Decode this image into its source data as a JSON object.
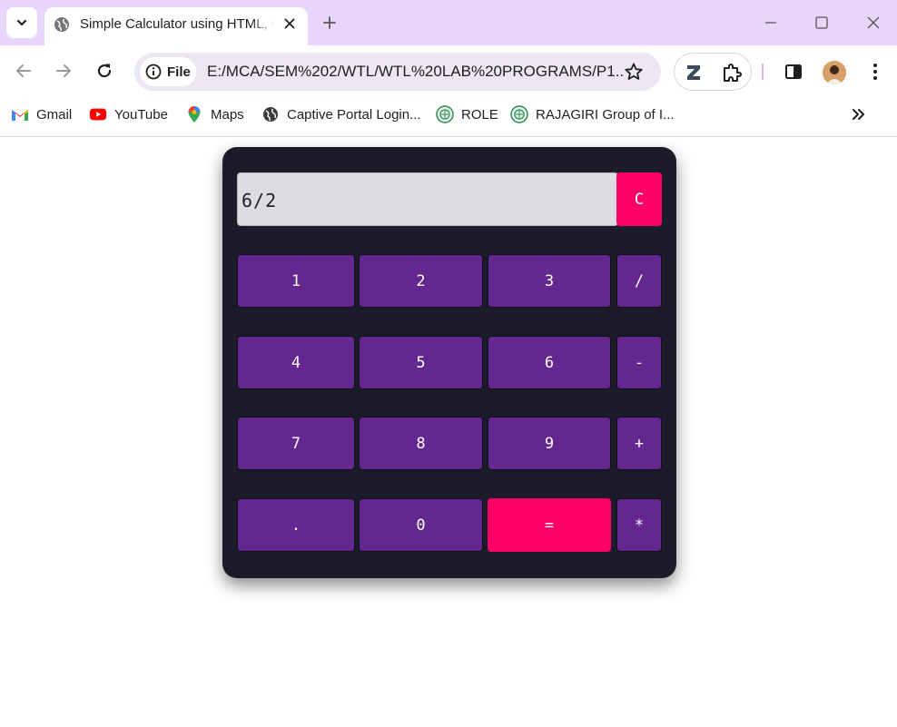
{
  "browser": {
    "tab_title": "Simple Calculator using HTML, CSS and JavaScript",
    "url_chip": "File",
    "url": "E:/MCA/SEM%202/WTL/WTL%20LAB%20PROGRAMS/P1...",
    "bookmarks": [
      {
        "label": "Gmail",
        "icon": "gmail-icon"
      },
      {
        "label": "YouTube",
        "icon": "youtube-icon"
      },
      {
        "label": "Maps",
        "icon": "maps-icon"
      },
      {
        "label": "Captive Portal Login...",
        "icon": "globe-icon"
      },
      {
        "label": "ROLE",
        "icon": "seal-icon"
      },
      {
        "label": "RAJAGIRI Group of I...",
        "icon": "seal-icon"
      }
    ],
    "colors": {
      "frame": "#e9d5fb",
      "omnibox": "#ede7f3"
    }
  },
  "calculator": {
    "display_value": "6/2",
    "keys": {
      "clear": "C",
      "one": "1",
      "two": "2",
      "three": "3",
      "divide": "/",
      "four": "4",
      "five": "5",
      "six": "6",
      "minus": "-",
      "seven": "7",
      "eight": "8",
      "nine": "9",
      "plus": "+",
      "dot": ".",
      "zero": "0",
      "equals": "=",
      "multiply": "*"
    },
    "colors": {
      "body": "#1c1b2a",
      "key": "#64278f",
      "accent": "#ff0067",
      "display": "#dcdce2"
    }
  }
}
